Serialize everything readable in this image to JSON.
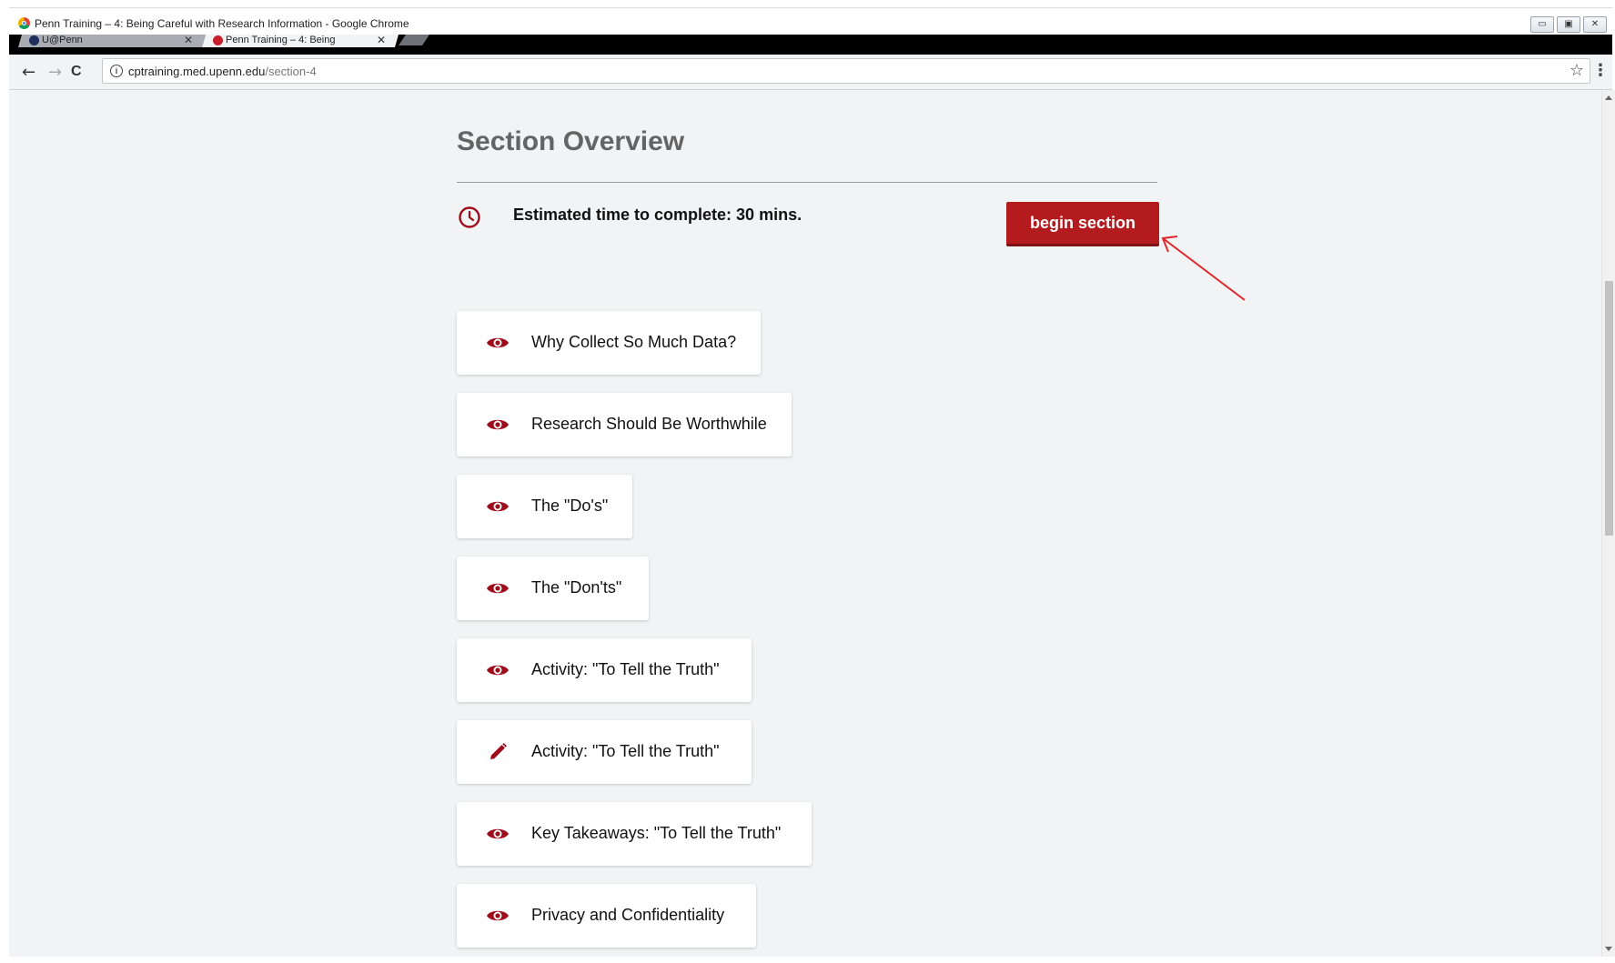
{
  "window": {
    "title": "Penn Training – 4: Being Careful with Research Information - Google Chrome",
    "controls": {
      "minimize": "▭",
      "maximize": "▣",
      "close": "✕"
    }
  },
  "tabs": [
    {
      "label": "U@Penn",
      "active": false,
      "close": "✕"
    },
    {
      "label": "Penn Training – 4: Being",
      "active": true,
      "close": "✕"
    }
  ],
  "toolbar": {
    "back": "←",
    "forward": "→",
    "reload": "C",
    "url_host": "cptraining.med.upenn.edu",
    "url_path": "/section-4",
    "info_icon": "i",
    "star_icon": "☆",
    "menu_icon": "⋮"
  },
  "page": {
    "title": "Section Overview",
    "estimated_time": "Estimated time to complete: 30 mins.",
    "begin_button": "begin section",
    "accent_color": "#b31b1f",
    "icon_color": "#9e0c1c",
    "items": [
      {
        "label": "Why Collect So Much Data?",
        "icon": "eye-icon"
      },
      {
        "label": "Research Should Be Worthwhile",
        "icon": "eye-icon"
      },
      {
        "label": "The \"Do's\"",
        "icon": "eye-icon"
      },
      {
        "label": "The \"Don'ts\"",
        "icon": "eye-icon"
      },
      {
        "label": "Activity: \"To Tell the Truth\"",
        "icon": "eye-icon"
      },
      {
        "label": "Activity: \"To Tell the Truth\"",
        "icon": "pencil-icon"
      },
      {
        "label": "Key Takeaways: \"To Tell the Truth\"",
        "icon": "eye-icon"
      },
      {
        "label": "Privacy and Confidentiality",
        "icon": "eye-icon"
      }
    ]
  }
}
